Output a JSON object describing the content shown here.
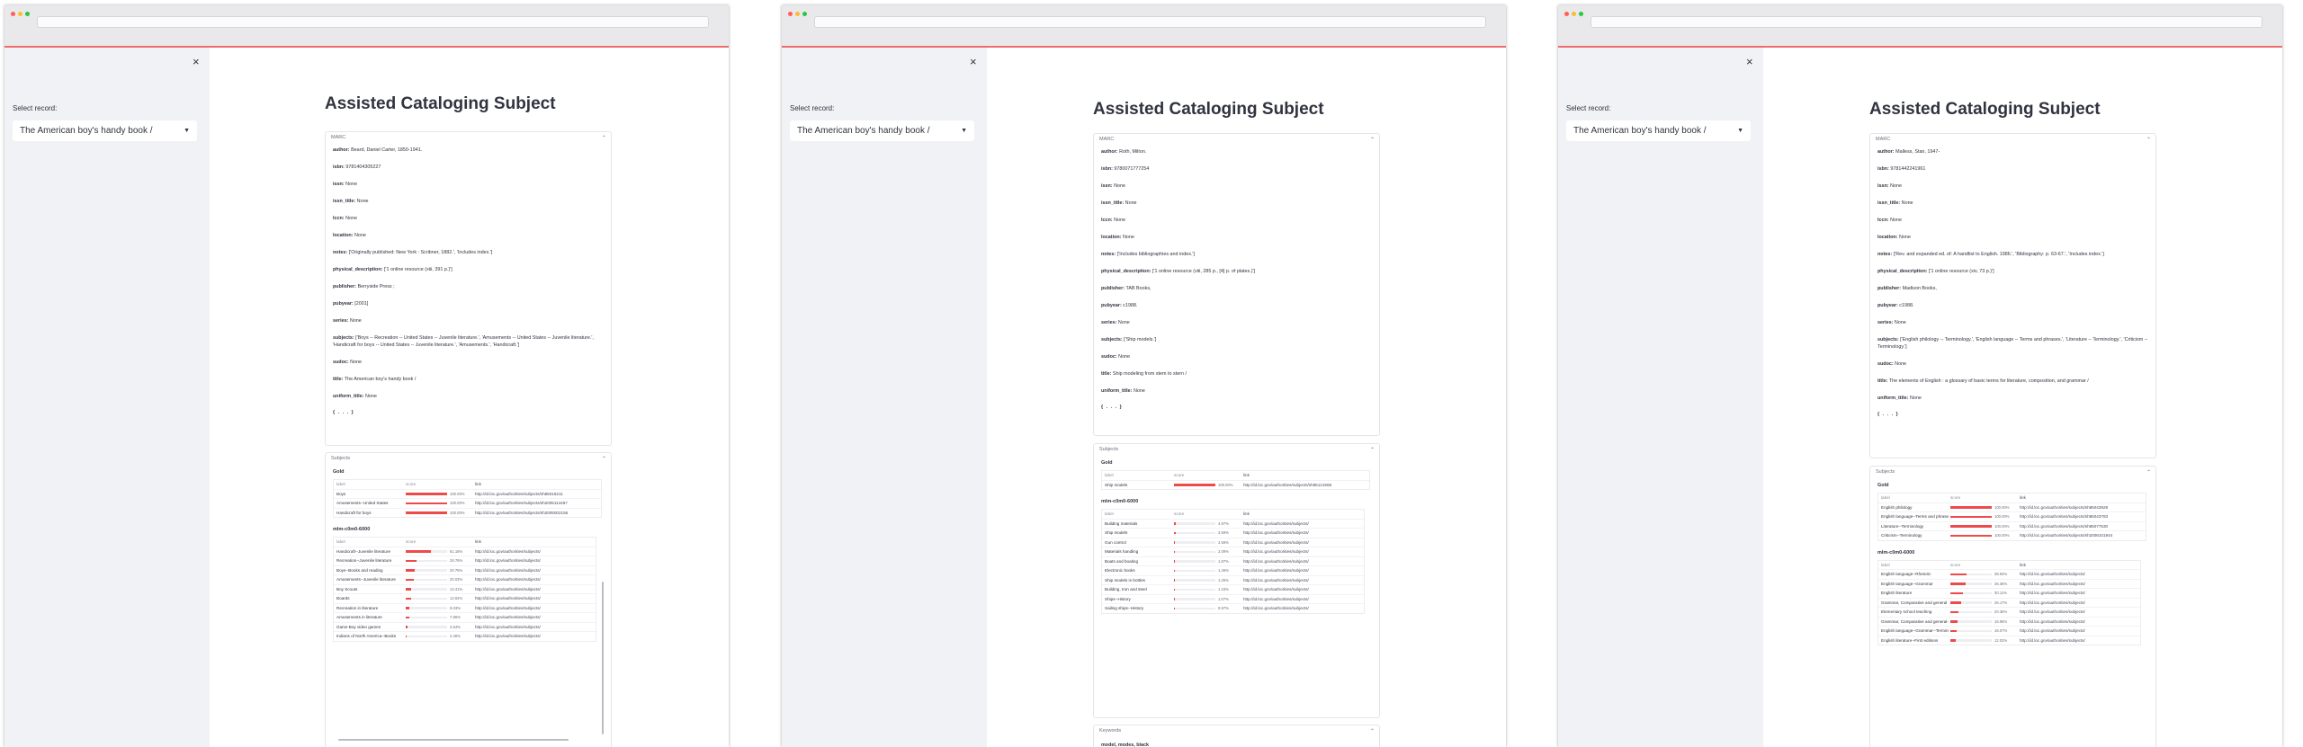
{
  "app": {
    "close_glyph": "×",
    "select_label": "Select record:",
    "title": "Assisted Cataloging Subject",
    "marc_label": "MARC",
    "subjects_label": "Subjects",
    "keywords_label": "Keywords",
    "collapse_glyph": "⌃",
    "more_label": "{ . . . }",
    "gold_label": "Gold",
    "model_label": "mlm-c0m0-6000",
    "headers": {
      "label": "label",
      "score": "score",
      "link": "link"
    },
    "field_names": {
      "author": "author:",
      "isbn": "isbn:",
      "issn": "issn:",
      "issn_title": "issn_title:",
      "lccn": "lccn:",
      "location": "location:",
      "notes": "notes:",
      "physical_description": "physical_description:",
      "publisher": "publisher:",
      "pubyear": "pubyear:",
      "series": "series:",
      "subjects": "subjects:",
      "sudoc": "sudoc:",
      "title": "title:",
      "uniform_title": "uniform_title:"
    },
    "colors": {
      "accent": "#ff4b4b",
      "sidebar": "#f0f2f6",
      "text": "#31333f"
    }
  },
  "windows": [
    {
      "selected_record": "The American boy's handy book /",
      "marc": {
        "author": "Beard, Daniel Carter, 1850-1941.",
        "isbn": "9781404305227",
        "issn": "None",
        "issn_title": "None",
        "lccn": "None",
        "location": "None",
        "notes": "['Originally published: New York : Scribner, 1882.', 'Includes index.']",
        "physical_description": "['1 online resource (xiii, 391 p.)']",
        "publisher": "Berryside Press ;",
        "pubyear": "[2001]",
        "series": "None",
        "subjects": "['Boys -- Recreation -- United States -- Juvenile literature.', 'Amusements -- United States -- Juvenile literature.', 'Handicraft for boys -- United States -- Juvenile literature.', 'Amusements.', 'Handicraft.']",
        "sudoc": "None",
        "title": "The American boy's handy book /",
        "uniform_title": "None"
      },
      "gold": [
        {
          "label": "Boys",
          "score": 1.0,
          "pct": "100.00%",
          "link": "http://id.loc.gov/authorities/subjects/sh85016211"
        },
        {
          "label": "Amusements--United States",
          "score": 1.0,
          "pct": "100.00%",
          "link": "http://id.loc.gov/authorities/subjects/sh2005114467"
        },
        {
          "label": "Handicraft for boys",
          "score": 1.0,
          "pct": "100.00%",
          "link": "http://id.loc.gov/authorities/subjects/sh2005002155"
        }
      ],
      "predicted": [
        {
          "label": "Handicraft--Juvenile literature",
          "score": 0.6116,
          "pct": "61.16%",
          "link": "http://id.loc.gov/authorities/subjects/"
        },
        {
          "label": "Recreation--Juvenile literature",
          "score": 0.2676,
          "pct": "26.76%",
          "link": "http://id.loc.gov/authorities/subjects/"
        },
        {
          "label": "Boys--Books and reading",
          "score": 0.2075,
          "pct": "20.75%",
          "link": "http://id.loc.gov/authorities/subjects/"
        },
        {
          "label": "Amusements--Juvenile literature",
          "score": 0.2003,
          "pct": "20.03%",
          "link": "http://id.loc.gov/authorities/subjects/"
        },
        {
          "label": "Boy Scouts",
          "score": 0.1341,
          "pct": "13.41%",
          "link": "http://id.loc.gov/authorities/subjects/"
        },
        {
          "label": "Boards",
          "score": 0.1284,
          "pct": "12.84%",
          "link": "http://id.loc.gov/authorities/subjects/"
        },
        {
          "label": "Recreation in literature",
          "score": 0.0903,
          "pct": "9.03%",
          "link": "http://id.loc.gov/authorities/subjects/"
        },
        {
          "label": "Amusements in literature",
          "score": 0.0786,
          "pct": "7.86%",
          "link": "http://id.loc.gov/authorities/subjects/"
        },
        {
          "label": "Game Boy video games",
          "score": 0.0354,
          "pct": "3.54%",
          "link": "http://id.loc.gov/authorities/subjects/"
        },
        {
          "label": "Indians of North America--Books",
          "score": 0.0246,
          "pct": "2.46%",
          "link": "http://id.loc.gov/authorities/subjects/"
        }
      ]
    },
    {
      "selected_record": "The American boy's handy book /",
      "marc": {
        "author": "Roth, Milton.",
        "isbn": "9780071777254",
        "issn": "None",
        "issn_title": "None",
        "lccn": "None",
        "location": "None",
        "notes": "['Includes bibliographies and index.']",
        "physical_description": "['1 online resource (viii, 285 p., [4] p. of plates.)']",
        "publisher": "TAB Books,",
        "pubyear": "c1988.",
        "series": "None",
        "subjects": "['Ship models.']",
        "sudoc": "None",
        "title": "Ship modeling from stem to stern /",
        "uniform_title": "None"
      },
      "gold": [
        {
          "label": "Ship models",
          "score": 1.0,
          "pct": "100.00%",
          "link": "http://id.loc.gov/authorities/subjects/sh85121558"
        }
      ],
      "predicted": [
        {
          "label": "Building materials",
          "score": 0.0497,
          "pct": "4.97%",
          "link": "http://id.loc.gov/authorities/subjects/"
        },
        {
          "label": "Ship models",
          "score": 0.0359,
          "pct": "3.59%",
          "link": "http://id.loc.gov/authorities/subjects/"
        },
        {
          "label": "Gun control",
          "score": 0.0256,
          "pct": "2.56%",
          "link": "http://id.loc.gov/authorities/subjects/"
        },
        {
          "label": "Materials handling",
          "score": 0.0209,
          "pct": "2.09%",
          "link": "http://id.loc.gov/authorities/subjects/"
        },
        {
          "label": "Boats and boating",
          "score": 0.0187,
          "pct": "1.87%",
          "link": "http://id.loc.gov/authorities/subjects/"
        },
        {
          "label": "Electronic books",
          "score": 0.0146,
          "pct": "1.46%",
          "link": "http://id.loc.gov/authorities/subjects/"
        },
        {
          "label": "Ship models in bottles",
          "score": 0.0125,
          "pct": "1.25%",
          "link": "http://id.loc.gov/authorities/subjects/"
        },
        {
          "label": "Building, Iron and steel",
          "score": 0.0115,
          "pct": "1.15%",
          "link": "http://id.loc.gov/authorities/subjects/"
        },
        {
          "label": "Ships--History",
          "score": 0.0107,
          "pct": "1.07%",
          "link": "http://id.loc.gov/authorities/subjects/"
        },
        {
          "label": "Sailing ships--History",
          "score": 0.0097,
          "pct": "0.97%",
          "link": "http://id.loc.gov/authorities/subjects/"
        }
      ],
      "keywords_peek": "model, modes, black"
    },
    {
      "selected_record": "The American boy's handy book /",
      "marc": {
        "author": "Malless, Stan, 1947-",
        "isbn": "9781442241961",
        "issn": "None",
        "issn_title": "None",
        "lccn": "None",
        "location": "None",
        "notes": "['Rev. and expanded ed. of: A handlist to English. 1986.', 'Bibliography: p. 63-67.', 'Includes index.']",
        "physical_description": "['1 online resource (xiv, 73 p.)']",
        "publisher": "Madison Books,",
        "pubyear": "c1988.",
        "series": "None",
        "subjects": "['English philology -- Terminology.', 'English language -- Terms and phrases.', 'Literature -- Terminology.', 'Criticism -- Terminology.']",
        "sudoc": "None",
        "title": "The elements of English : a glossary of basic terms for literature, composition, and grammar /",
        "uniform_title": "None"
      },
      "gold": [
        {
          "label": "English philology",
          "score": 1.0,
          "pct": "100.00%",
          "link": "http://id.loc.gov/authorities/subjects/sh85043929"
        },
        {
          "label": "English language--Terms and phrases",
          "score": 1.0,
          "pct": "100.00%",
          "link": "http://id.loc.gov/authorities/subjects/sh85043783"
        },
        {
          "label": "Literature--Terminology",
          "score": 1.0,
          "pct": "100.00%",
          "link": "http://id.loc.gov/authorities/subjects/sh85077530"
        },
        {
          "label": "Criticism--Terminology",
          "score": 1.0,
          "pct": "100.00%",
          "link": "http://id.loc.gov/authorities/subjects/sh2008101944"
        }
      ],
      "predicted": [
        {
          "label": "English language--Rhetoric",
          "score": 0.3894,
          "pct": "38.94%",
          "link": "http://id.loc.gov/authorities/subjects/"
        },
        {
          "label": "English language--Grammar",
          "score": 0.3636,
          "pct": "36.36%",
          "link": "http://id.loc.gov/authorities/subjects/"
        },
        {
          "label": "English literature",
          "score": 0.3011,
          "pct": "30.11%",
          "link": "http://id.loc.gov/authorities/subjects/"
        },
        {
          "label": "Grammar, Comparative and general",
          "score": 0.2617,
          "pct": "26.17%",
          "link": "http://id.loc.gov/authorities/subjects/"
        },
        {
          "label": "Elementary school teaching",
          "score": 0.2035,
          "pct": "20.35%",
          "link": "http://id.loc.gov/authorities/subjects/"
        },
        {
          "label": "Grammar, Comparative and general--Composition",
          "score": 0.1696,
          "pct": "16.96%",
          "link": "http://id.loc.gov/authorities/subjects/"
        },
        {
          "label": "English language--Grammar--Terminology",
          "score": 0.1607,
          "pct": "16.07%",
          "link": "http://id.loc.gov/authorities/subjects/"
        },
        {
          "label": "English literature--First editions",
          "score": 0.1202,
          "pct": "12.02%",
          "link": "http://id.loc.gov/authorities/subjects/"
        }
      ]
    }
  ]
}
